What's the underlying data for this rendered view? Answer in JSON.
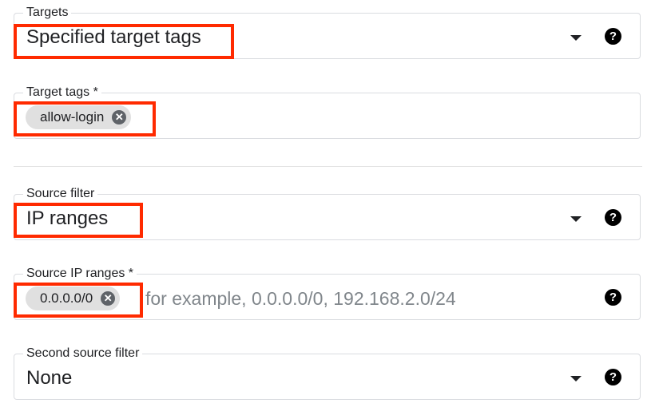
{
  "targets": {
    "label": "Targets",
    "value": "Specified target tags",
    "help": "?"
  },
  "target_tags": {
    "label": "Target tags *",
    "chip": "allow-login",
    "chip_remove": "✕"
  },
  "source_filter": {
    "label": "Source filter",
    "value": "IP ranges",
    "help": "?"
  },
  "source_ip_ranges": {
    "label": "Source IP ranges *",
    "chip": "0.0.0.0/0",
    "chip_remove": "✕",
    "placeholder": "for example, 0.0.0.0/0, 192.168.2.0/24",
    "help": "?"
  },
  "second_source_filter": {
    "label": "Second source filter",
    "value": "None",
    "help": "?"
  },
  "highlight_color": "#ff2a00"
}
